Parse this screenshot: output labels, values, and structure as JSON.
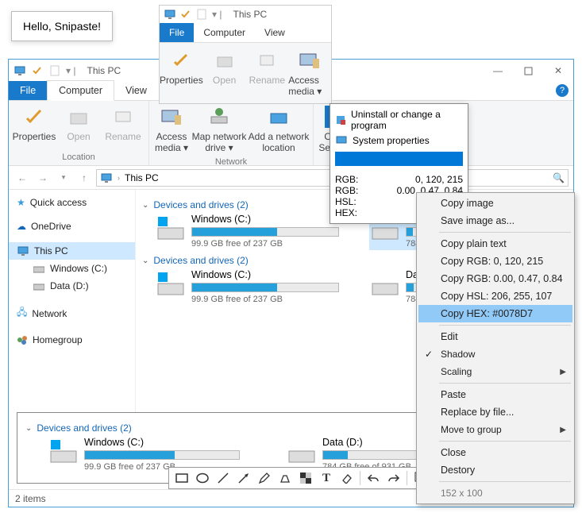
{
  "tooltip": "Hello, Snipaste!",
  "mini": {
    "title": "This PC",
    "tabs": [
      "File",
      "Computer",
      "View"
    ],
    "buttons": {
      "properties": "Properties",
      "open": "Open",
      "rename": "Rename",
      "media": "Access media ▾"
    }
  },
  "explorer": {
    "title": "This PC",
    "tabs": {
      "file": "File",
      "computer": "Computer",
      "view": "View"
    },
    "ribbon": {
      "location": {
        "properties": "Properties",
        "open": "Open",
        "rename": "Rename",
        "group": "Location"
      },
      "network": {
        "media": "Access media ▾",
        "map": "Map network drive ▾",
        "add": "Add a network location",
        "group": "Network"
      },
      "system": {
        "open": "Open Settings",
        "uninstall": "Uninstall or change a program",
        "sysprops": "System properties"
      }
    },
    "address": "This PC",
    "sidebar": {
      "quick": "Quick access",
      "onedrive": "OneDrive",
      "thispc": "This PC",
      "windowsc": "Windows (C:)",
      "datad": "Data (D:)",
      "network": "Network",
      "homegroup": "Homegroup"
    },
    "section": "Devices and drives (2)",
    "drives": {
      "c": {
        "name": "Windows (C:)",
        "free": "99.9 GB free of 237 GB",
        "pct": 58
      },
      "d": {
        "name": "Data (D:)",
        "free": "784 GB free of 931 GB",
        "pct": 16
      },
      "d_short": "784 G"
    },
    "status": "2 items"
  },
  "picker": {
    "uninstall": "Uninstall or change a program",
    "sysprops": "System properties",
    "rgb_int": "0, 120, 215",
    "rgb_float": "0.00, 0.47, 0.84",
    "hsl": "206,  2",
    "hex": "#00",
    "labels": {
      "rgb": "RGB:",
      "hsl": "HSL:",
      "hex": "HEX:"
    }
  },
  "ctx": {
    "copy_image": "Copy image",
    "save_as": "Save image as...",
    "copy_plain": "Copy plain text",
    "copy_rgb_int": "Copy RGB: 0, 120, 215",
    "copy_rgb_f": "Copy RGB: 0.00, 0.47, 0.84",
    "copy_hsl": "Copy HSL: 206, 255, 107",
    "copy_hex": "Copy HEX: #0078D7",
    "edit": "Edit",
    "shadow": "Shadow",
    "scaling": "Scaling",
    "paste": "Paste",
    "replace": "Replace by file...",
    "move": "Move to group",
    "close": "Close",
    "destroy": "Destory",
    "dims": "152 x 100"
  }
}
